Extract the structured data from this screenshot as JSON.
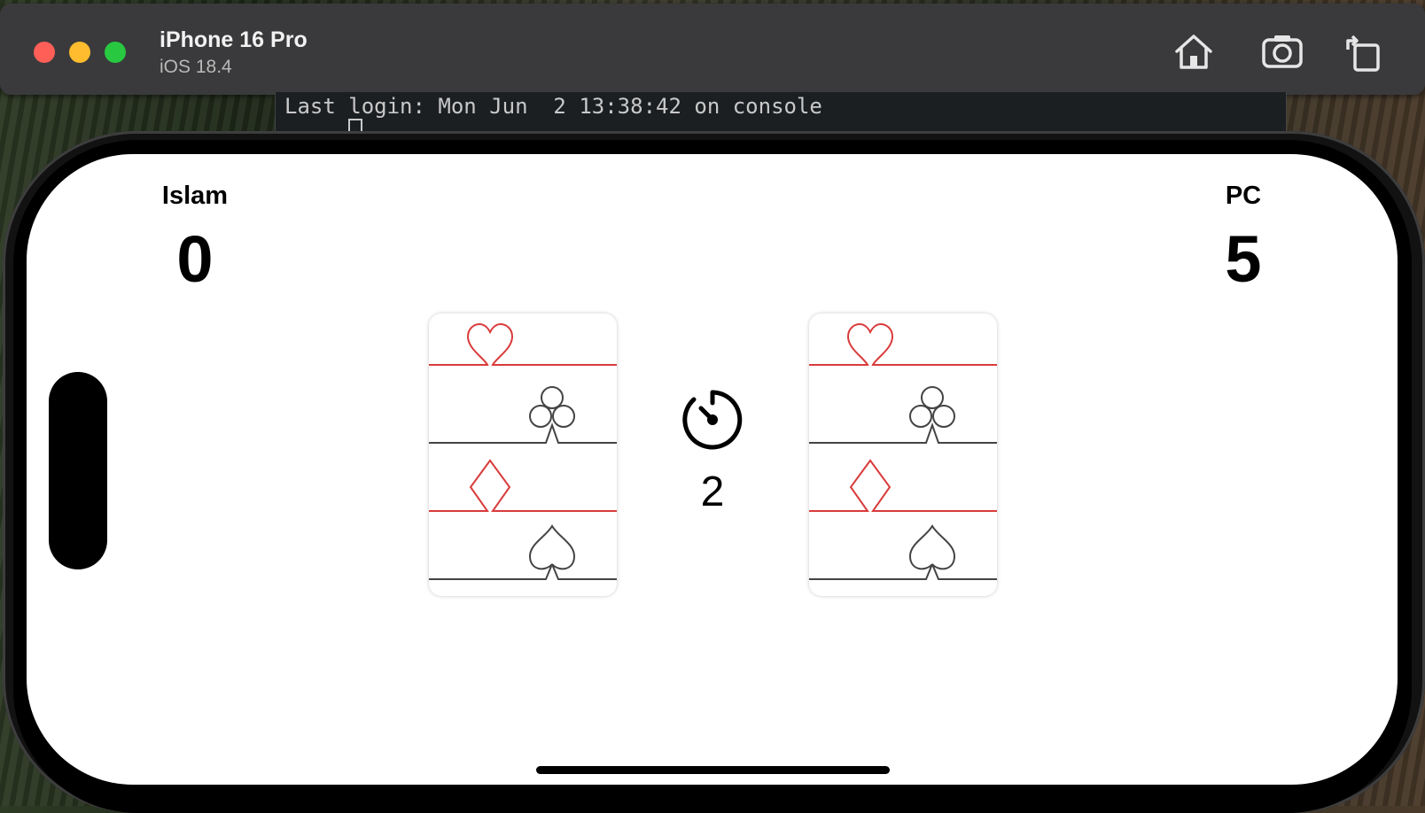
{
  "window": {
    "device_name": "iPhone 16 Pro",
    "os_version": "iOS 18.4",
    "toolbar_icons": [
      "home-icon",
      "screenshot-icon",
      "rotate-icon"
    ]
  },
  "terminal": {
    "text": "Last login: Mon Jun  2 13:38:42 on console"
  },
  "game": {
    "player": {
      "name": "Islam",
      "score": "0"
    },
    "opponent": {
      "name": "PC",
      "score": "5"
    },
    "timer": {
      "icon": "timer-icon",
      "value": "2"
    },
    "cards": [
      {
        "side": "player",
        "face": "card-back",
        "suits": [
          "heart",
          "club",
          "diamond",
          "spade"
        ]
      },
      {
        "side": "opponent",
        "face": "card-back",
        "suits": [
          "heart",
          "club",
          "diamond",
          "spade"
        ]
      }
    ]
  },
  "colors": {
    "red_suit": "#d93b3b",
    "black_suit": "#444444",
    "traffic_red": "#ff5f57",
    "traffic_yellow": "#febc2e",
    "traffic_green": "#28c840"
  }
}
